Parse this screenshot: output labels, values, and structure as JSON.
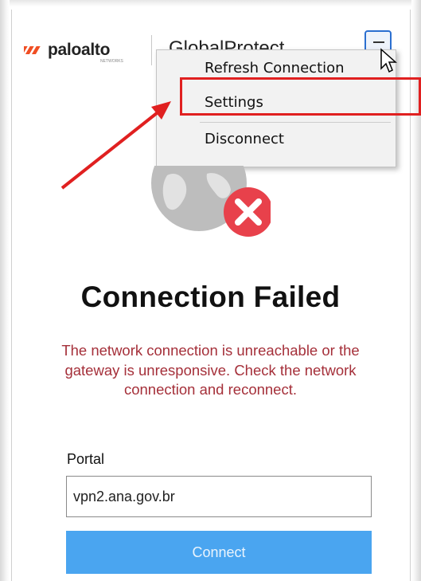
{
  "brand": {
    "logo_text": "paloalto",
    "logo_subtext": "NETWORKS",
    "app_title": "GlobalProtect"
  },
  "menu": {
    "items": [
      {
        "label": "Refresh Connection"
      },
      {
        "label": "Settings"
      },
      {
        "label": "Disconnect"
      }
    ],
    "highlighted": "Settings"
  },
  "status": {
    "title": "Connection Failed",
    "message": "The network connection is unreachable or the gateway is unresponsive. Check the network connection and reconnect."
  },
  "portal": {
    "label": "Portal",
    "value": "vpn2.ana.gov.br"
  },
  "connect_button": {
    "label": "Connect"
  },
  "colors": {
    "accent": "#4aa5f0",
    "error_text": "#a5303a",
    "error_icon": "#e8414b",
    "annotation": "#e02020",
    "logo_orange": "#f04e23"
  },
  "icons": [
    "paloalto-logo-icon",
    "menu-icon",
    "cursor-icon",
    "globe-icon",
    "error-x-icon",
    "annotation-arrow"
  ]
}
